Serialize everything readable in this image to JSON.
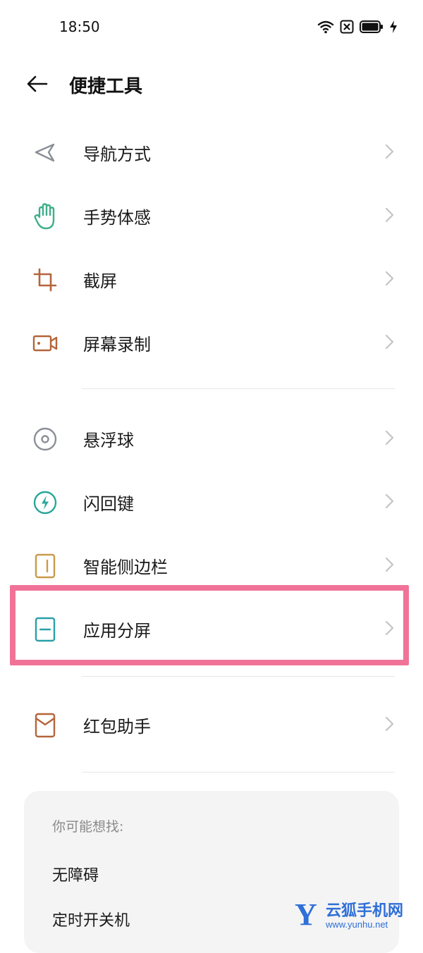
{
  "status": {
    "time": "18:50"
  },
  "header": {
    "title": "便捷工具"
  },
  "items": [
    {
      "label": "导航方式"
    },
    {
      "label": "手势体感"
    },
    {
      "label": "截屏"
    },
    {
      "label": "屏幕录制"
    },
    {
      "label": "悬浮球"
    },
    {
      "label": "闪回键"
    },
    {
      "label": "智能侧边栏"
    },
    {
      "label": "应用分屏"
    },
    {
      "label": "红包助手"
    }
  ],
  "suggest": {
    "title": "你可能想找:",
    "links": [
      "无障碍",
      "定时开关机"
    ]
  },
  "watermark": {
    "logo": "Y",
    "name": "云狐手机网",
    "url": "www.yunhu.net"
  },
  "colors": {
    "highlight": "#f07397",
    "nav_icon": "#8a8f97",
    "gesture_icon": "#3fae8a",
    "screenshot_icon": "#b5643a",
    "record_icon": "#b5643a",
    "float_icon": "#8a8f97",
    "flash_icon": "#2aa69a",
    "sidebar_icon": "#c99a4a",
    "split_icon": "#2aa0a8",
    "redpacket_icon": "#b5643a"
  },
  "icons": [
    "navigation-icon",
    "hand-icon",
    "crop-icon",
    "video-camera-icon",
    "float-ball-icon",
    "lightning-icon",
    "sidebar-icon",
    "split-screen-icon",
    "envelope-icon",
    "chevron-right-icon",
    "back-arrow-icon",
    "wifi-icon",
    "sim-x-icon",
    "battery-icon",
    "charging-icon"
  ]
}
